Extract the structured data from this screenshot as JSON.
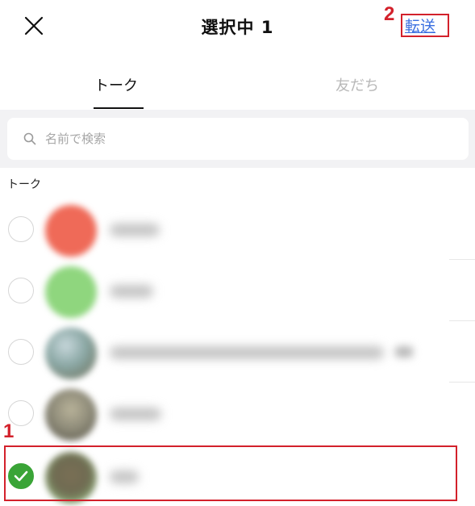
{
  "header": {
    "close_icon": "close-icon",
    "title": "選択中 1",
    "forward_label": "転送"
  },
  "annotations": {
    "forward_number": "2",
    "selected_row_number": "1",
    "color": "#d3212b"
  },
  "tabs": [
    {
      "label": "トーク",
      "active": true
    },
    {
      "label": "友だち",
      "active": false
    }
  ],
  "search": {
    "icon": "search-icon",
    "placeholder": "名前で検索"
  },
  "section": {
    "label": "トーク"
  },
  "chats": [
    {
      "name_blurred": true,
      "selected": false,
      "avatar_color": "#ef6a58"
    },
    {
      "name_blurred": true,
      "selected": false,
      "avatar_color": "#8fd67e"
    },
    {
      "name_blurred": true,
      "selected": false,
      "avatar_color": "#8aa7a4"
    },
    {
      "name_blurred": true,
      "selected": false,
      "avatar_color": "#8d8a78"
    },
    {
      "name_blurred": true,
      "selected": true,
      "avatar_color": "#7a6f55"
    }
  ],
  "colors": {
    "accent_link": "#3a6fe0",
    "check_green": "#3aa437",
    "inactive_tab": "#b8b8b8"
  }
}
